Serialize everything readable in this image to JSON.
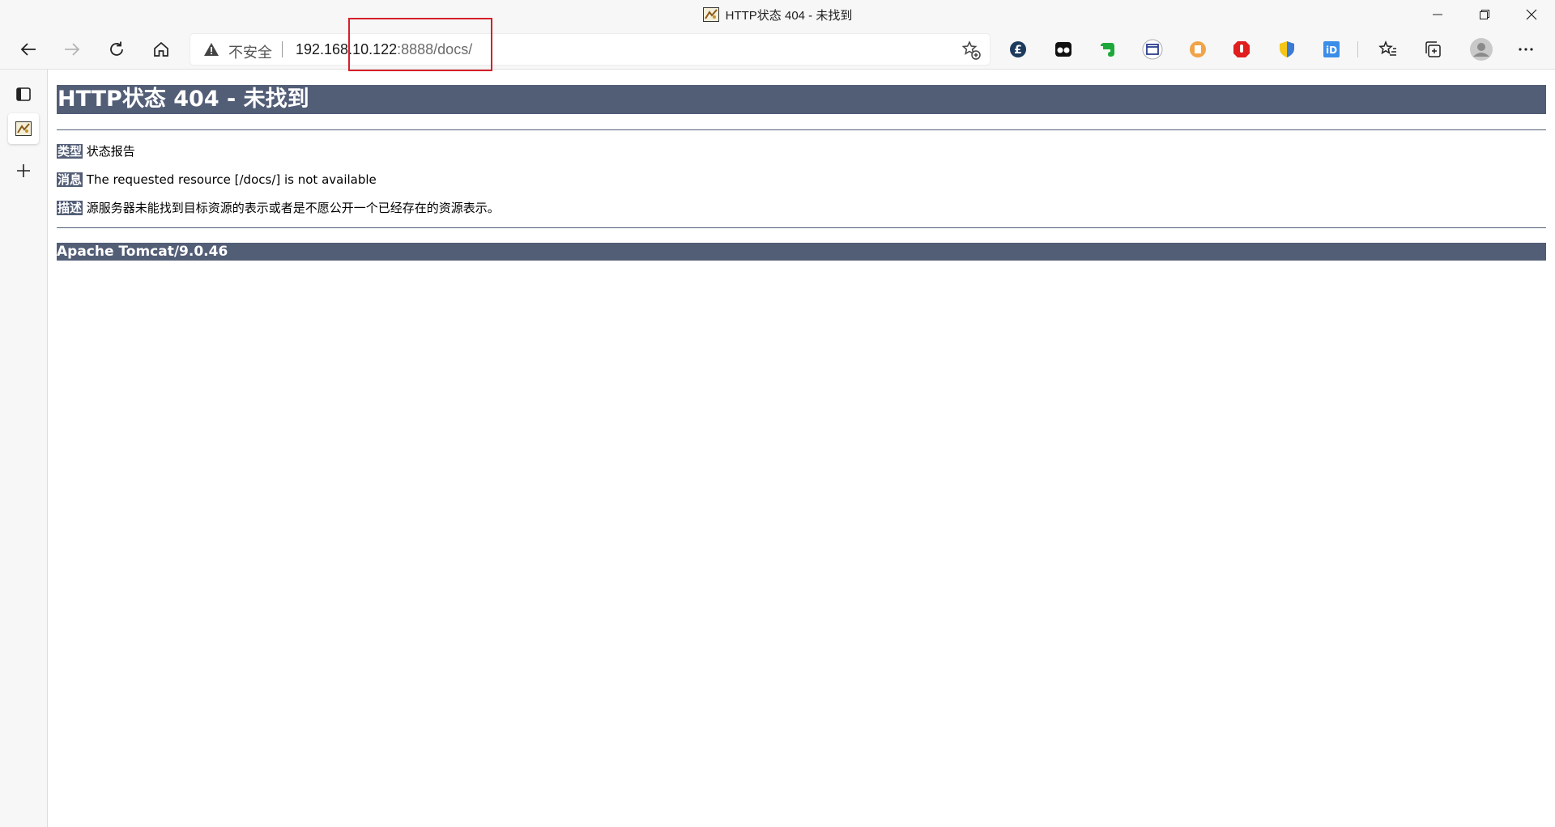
{
  "window": {
    "title": "HTTP状态 404 - 未找到"
  },
  "address_bar": {
    "security_label": "不安全",
    "url_host": "192.168.10.122",
    "url_path": ":8888/docs/"
  },
  "page": {
    "heading": "HTTP状态 404 - 未找到",
    "rows": [
      {
        "label": "类型",
        "value": "状态报告"
      },
      {
        "label": "消息",
        "value": "The requested resource [/docs/] is not available"
      },
      {
        "label": "描述",
        "value": "源服务器未能找到目标资源的表示或者是不愿公开一个已经存在的资源表示。"
      }
    ],
    "footer": "Apache Tomcat/9.0.46"
  },
  "colors": {
    "tomcat_header": "#525d76",
    "highlight_box": "#d4202a",
    "warning_icon": "#444444"
  }
}
